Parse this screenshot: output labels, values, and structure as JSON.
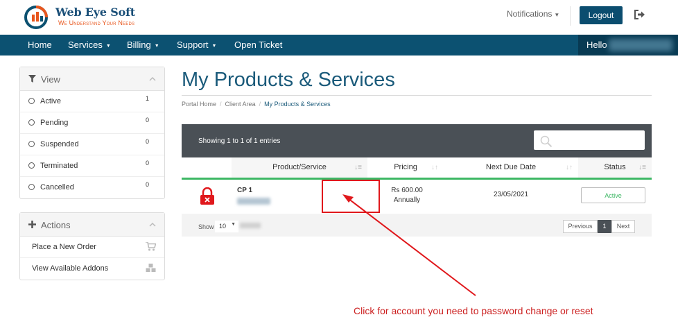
{
  "brand": {
    "name": "Web Eye Soft",
    "tagline": "We Understand Your Needs"
  },
  "header": {
    "notifications_label": "Notifications",
    "logout_label": "Logout"
  },
  "nav": {
    "items": [
      {
        "label": "Home",
        "dropdown": false
      },
      {
        "label": "Services",
        "dropdown": true
      },
      {
        "label": "Billing",
        "dropdown": true
      },
      {
        "label": "Support",
        "dropdown": true
      },
      {
        "label": "Open Ticket",
        "dropdown": false
      }
    ],
    "hello_label": "Hello"
  },
  "sidebar": {
    "view_panel": {
      "title": "View",
      "items": [
        {
          "label": "Active",
          "count": "1"
        },
        {
          "label": "Pending",
          "count": "0"
        },
        {
          "label": "Suspended",
          "count": "0"
        },
        {
          "label": "Terminated",
          "count": "0"
        },
        {
          "label": "Cancelled",
          "count": "0"
        }
      ]
    },
    "actions_panel": {
      "title": "Actions",
      "items": [
        {
          "label": "Place a New Order",
          "icon": "cart-icon"
        },
        {
          "label": "View Available Addons",
          "icon": "cubes-icon"
        }
      ]
    }
  },
  "main": {
    "title": "My Products & Services",
    "breadcrumb": [
      "Portal Home",
      "Client Area",
      "My Products & Services"
    ],
    "table": {
      "info": "Showing 1 to 1 of 1 entries",
      "columns": [
        "Product/Service",
        "Pricing",
        "Next Due Date",
        "Status"
      ],
      "rows": [
        {
          "product": "CP 1",
          "price": "Rs 600.00",
          "cycle": "Annually",
          "due": "23/05/2021",
          "status": "Active"
        }
      ],
      "show_label": "Show",
      "show_value": "10",
      "pagination": {
        "prev": "Previous",
        "current": "1",
        "next": "Next"
      }
    }
  },
  "annotation": {
    "text": "Click for account you need to password change or reset"
  },
  "colors": {
    "brand_blue": "#0c5171",
    "status_green": "#3db764",
    "annotation_red": "#e0181c"
  }
}
